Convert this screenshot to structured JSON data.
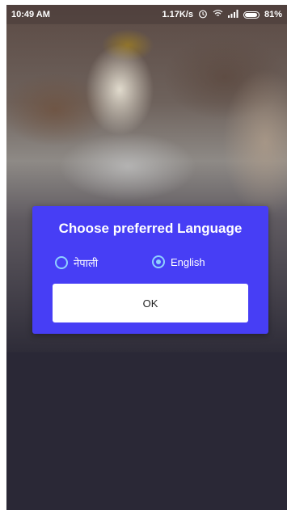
{
  "status_bar": {
    "time": "10:49 AM",
    "network_speed": "1.17K/s",
    "battery": "81%"
  },
  "dialog": {
    "title": "Choose preferred Language",
    "options": [
      {
        "label": "नेपाली",
        "selected": false
      },
      {
        "label": "English",
        "selected": true
      }
    ],
    "ok_label": "OK",
    "background_color": "#473ef5",
    "radio_color": "#8fd0ff"
  },
  "icons": [
    "alarm-icon",
    "wifi-icon",
    "signal-icon",
    "battery-icon"
  ]
}
